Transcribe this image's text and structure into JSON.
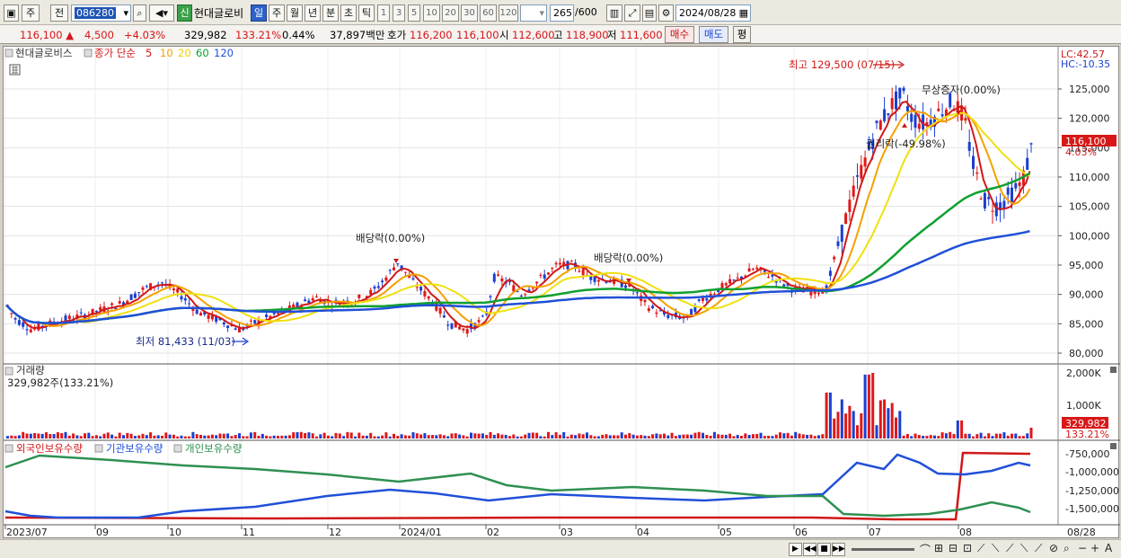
{
  "toolbar": {
    "tab_week": "주",
    "tab_prev": "전",
    "code": "086280",
    "shin": "신",
    "stock_name": "현대글로비",
    "periods": [
      "일",
      "주",
      "월",
      "년",
      "분",
      "초",
      "틱"
    ],
    "selected_period": "일",
    "numbers": [
      "1",
      "3",
      "5",
      "10",
      "20",
      "30",
      "60",
      "120"
    ],
    "count": "265",
    "count_max": "/600",
    "date": "2024/08/28"
  },
  "quote": {
    "price": "116,100",
    "change": "4,500",
    "change_pct": "+4.03%",
    "volume": "329,982",
    "vol_ratio": "133.21%",
    "turnover": "0.44%",
    "amount": "37,897백만",
    "hoga_label": "호가",
    "ask": "116,200",
    "bid": "116,100",
    "open_label": "시",
    "open": "112,600",
    "high_label": "고",
    "high": "118,900",
    "low_label": "저",
    "low": "111,600",
    "buy": "매수",
    "sell": "매도",
    "avg": "평"
  },
  "legend": {
    "name": "현대글로비스",
    "ma_title": "종가 단순",
    "ma_periods": [
      "5",
      "10",
      "20",
      "60",
      "120"
    ],
    "ma_colors": [
      "#d01818",
      "#f5a000",
      "#f0e010",
      "#10a030",
      "#2050d8"
    ]
  },
  "price_panel": {
    "lc": "LC:42.57",
    "hc": "HC:-10.35",
    "y_ticks": [
      "125,000",
      "120,000",
      "115,000",
      "110,000",
      "105,000",
      "100,000",
      "95,000",
      "90,000",
      "85,000",
      "80,000"
    ],
    "current_price_box": "116,100",
    "current_pct": "4.03%",
    "high_annotation": "최고 129,500 (07/15)",
    "low_annotation": "최저 81,433 (11/03)",
    "dividend1": "배당락(0.00%)",
    "dividend2": "배당락(0.00%)",
    "bonus_issue": "무상증자(0.00%)",
    "ex_rights": "권리락(-49.98%)"
  },
  "volume_panel": {
    "title": "거래량",
    "value": "329,982주(133.21%)",
    "y_ticks": [
      "2,000K",
      "1,000K"
    ],
    "current_box": "329,982",
    "current_pct": "133.21%"
  },
  "holdings_panel": {
    "titles": [
      "외국인보유수량",
      "기관보유수량",
      "개인보유수량"
    ],
    "colors": [
      "#d01818",
      "#2050d8",
      "#2e9050"
    ],
    "y_ticks": [
      "-750,000",
      "-1,000,000",
      "-1,250,000",
      "-1,500,000"
    ]
  },
  "x_axis": {
    "labels": [
      "2023/07",
      "09",
      "10",
      "11",
      "12",
      "2024/01",
      "02",
      "03",
      "04",
      "05",
      "06",
      "07",
      "08"
    ],
    "right_label": "08/28"
  },
  "chart_data": {
    "type": "line",
    "title": "현대글로비스",
    "y_range": [
      80000,
      130000
    ],
    "moving_averages": [
      {
        "name": "5",
        "color": "#d01818"
      },
      {
        "name": "10",
        "color": "#f5a000"
      },
      {
        "name": "20",
        "color": "#f0e010"
      },
      {
        "name": "60",
        "color": "#10a030"
      },
      {
        "name": "120",
        "color": "#2050d8"
      }
    ],
    "x": [
      "2023/07",
      "08",
      "09",
      "10",
      "11",
      "12",
      "2024/01",
      "02",
      "03",
      "04",
      "05",
      "06",
      "07",
      "08"
    ],
    "series": [
      {
        "name": "5",
        "values": [
          86500,
          85000,
          86500,
          92000,
          84000,
          89000,
          95000,
          85000,
          95000,
          86500,
          94000,
          91000,
          124000,
          116100
        ]
      },
      {
        "name": "120",
        "values": [
          85500,
          86000,
          87500,
          89000,
          89000,
          88500,
          88000,
          88000,
          89000,
          89500,
          90000,
          91000,
          97000,
          101000
        ]
      }
    ]
  }
}
